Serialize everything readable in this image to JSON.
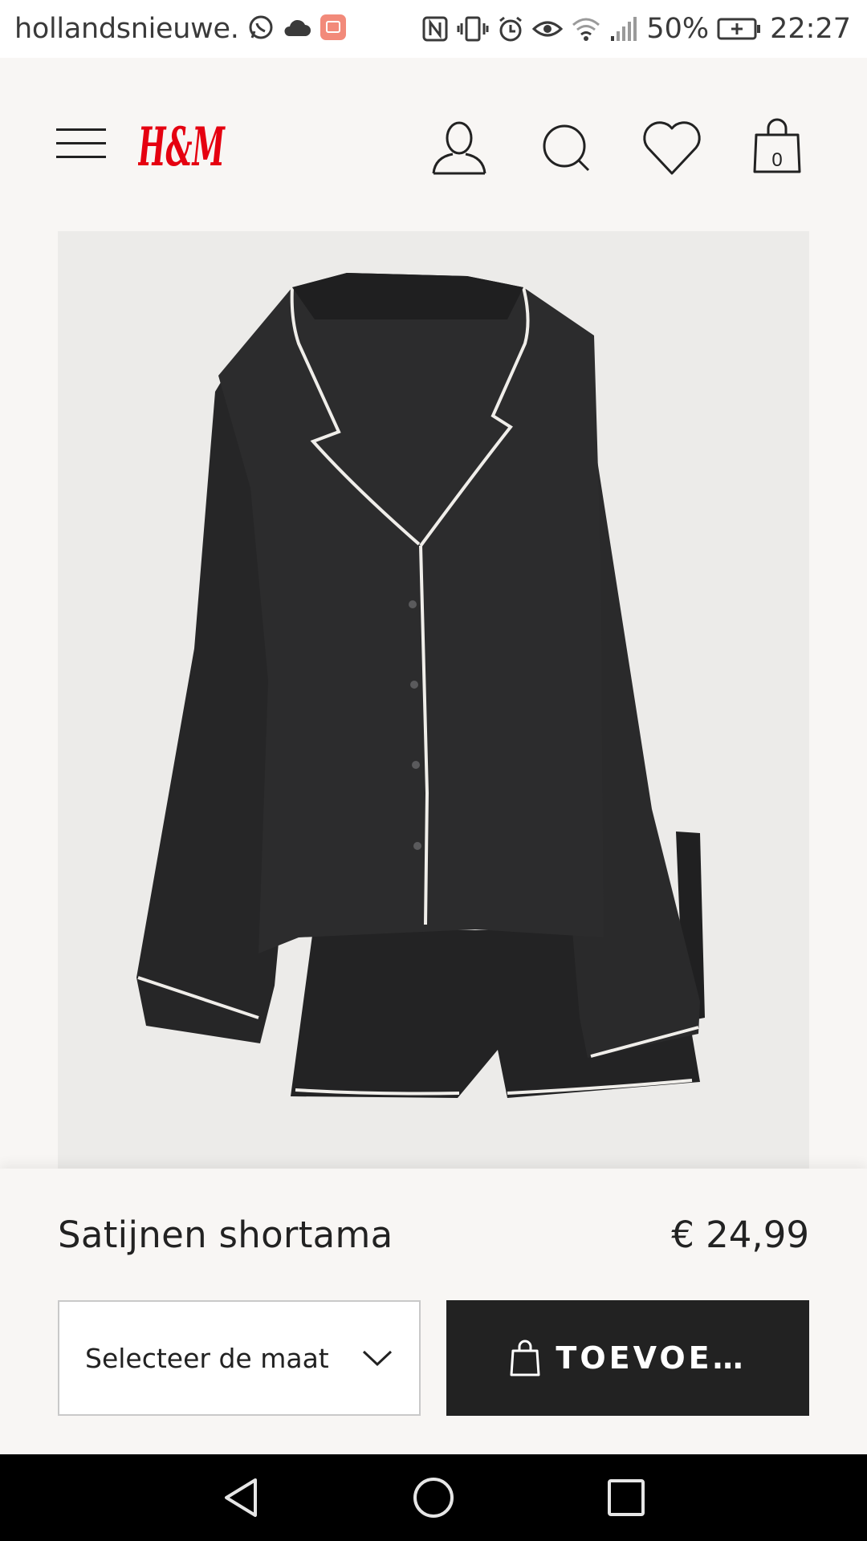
{
  "status_bar": {
    "app_label": "hollandsnieuwe.",
    "battery": "50%",
    "time": "22:27"
  },
  "header": {
    "logo_text": "H&M",
    "cart_count": "0",
    "brand_color": "#e50010"
  },
  "product": {
    "name": "Satijnen shortama",
    "price": "€ 24,99",
    "size_select_label": "Selecteer de maat",
    "add_button_label": "TOEVOE…"
  },
  "icons": {
    "menu": "hamburger-icon",
    "account": "user-icon",
    "search": "search-icon",
    "wishlist": "heart-icon",
    "cart": "shopping-bag-icon",
    "size_dropdown": "chevron-down-icon",
    "nav_back": "back-triangle-icon",
    "nav_home": "home-circle-icon",
    "nav_recents": "recents-square-icon"
  }
}
